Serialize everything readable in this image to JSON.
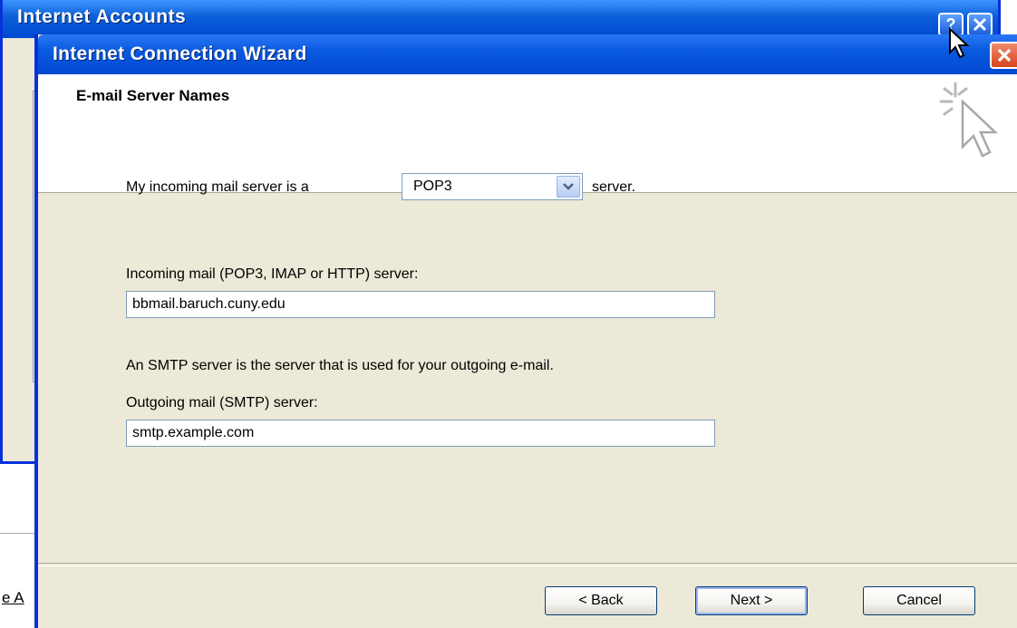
{
  "background_window": {
    "title": "Internet Accounts",
    "help_button": "?",
    "link_fragment": "e A"
  },
  "wizard": {
    "title": "Internet Connection Wizard",
    "close_button": "✕",
    "heading": "E-mail Server Names",
    "incoming_prefix": "My incoming mail server is a",
    "incoming_suffix": "server.",
    "server_type": {
      "selected": "POP3"
    },
    "incoming_label": "Incoming mail (POP3, IMAP or HTTP) server:",
    "incoming_value": "bbmail.baruch.cuny.edu",
    "smtp_note": "An SMTP server is the server that is used for your outgoing e-mail.",
    "outgoing_label": "Outgoing mail (SMTP) server:",
    "outgoing_value": "smtp.example.com",
    "buttons": {
      "back": "< Back",
      "next": "Next >",
      "cancel": "Cancel"
    }
  },
  "colors": {
    "titlebar_blue": "#0a5ae0",
    "dialog_face": "#ece9d8",
    "close_red": "#d6451c"
  }
}
